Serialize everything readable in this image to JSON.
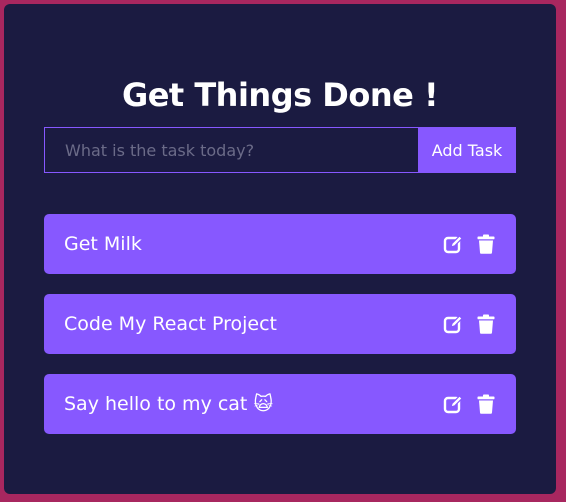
{
  "app": {
    "title": "Get Things Done !"
  },
  "form": {
    "input_placeholder": "What is the task today?",
    "input_value": "",
    "add_button_label": "Add Task"
  },
  "todos": [
    {
      "text": "Get Milk",
      "edit_icon": "edit-icon",
      "delete_icon": "trash-icon"
    },
    {
      "text": "Code My React Project",
      "edit_icon": "edit-icon",
      "delete_icon": "trash-icon"
    },
    {
      "text": "Say hello to my cat 🙀",
      "edit_icon": "edit-icon",
      "delete_icon": "trash-icon"
    }
  ],
  "colors": {
    "page_background": "#a8275f",
    "card_background": "#1b1b41",
    "accent": "#8758ff",
    "text": "#ffffff"
  }
}
